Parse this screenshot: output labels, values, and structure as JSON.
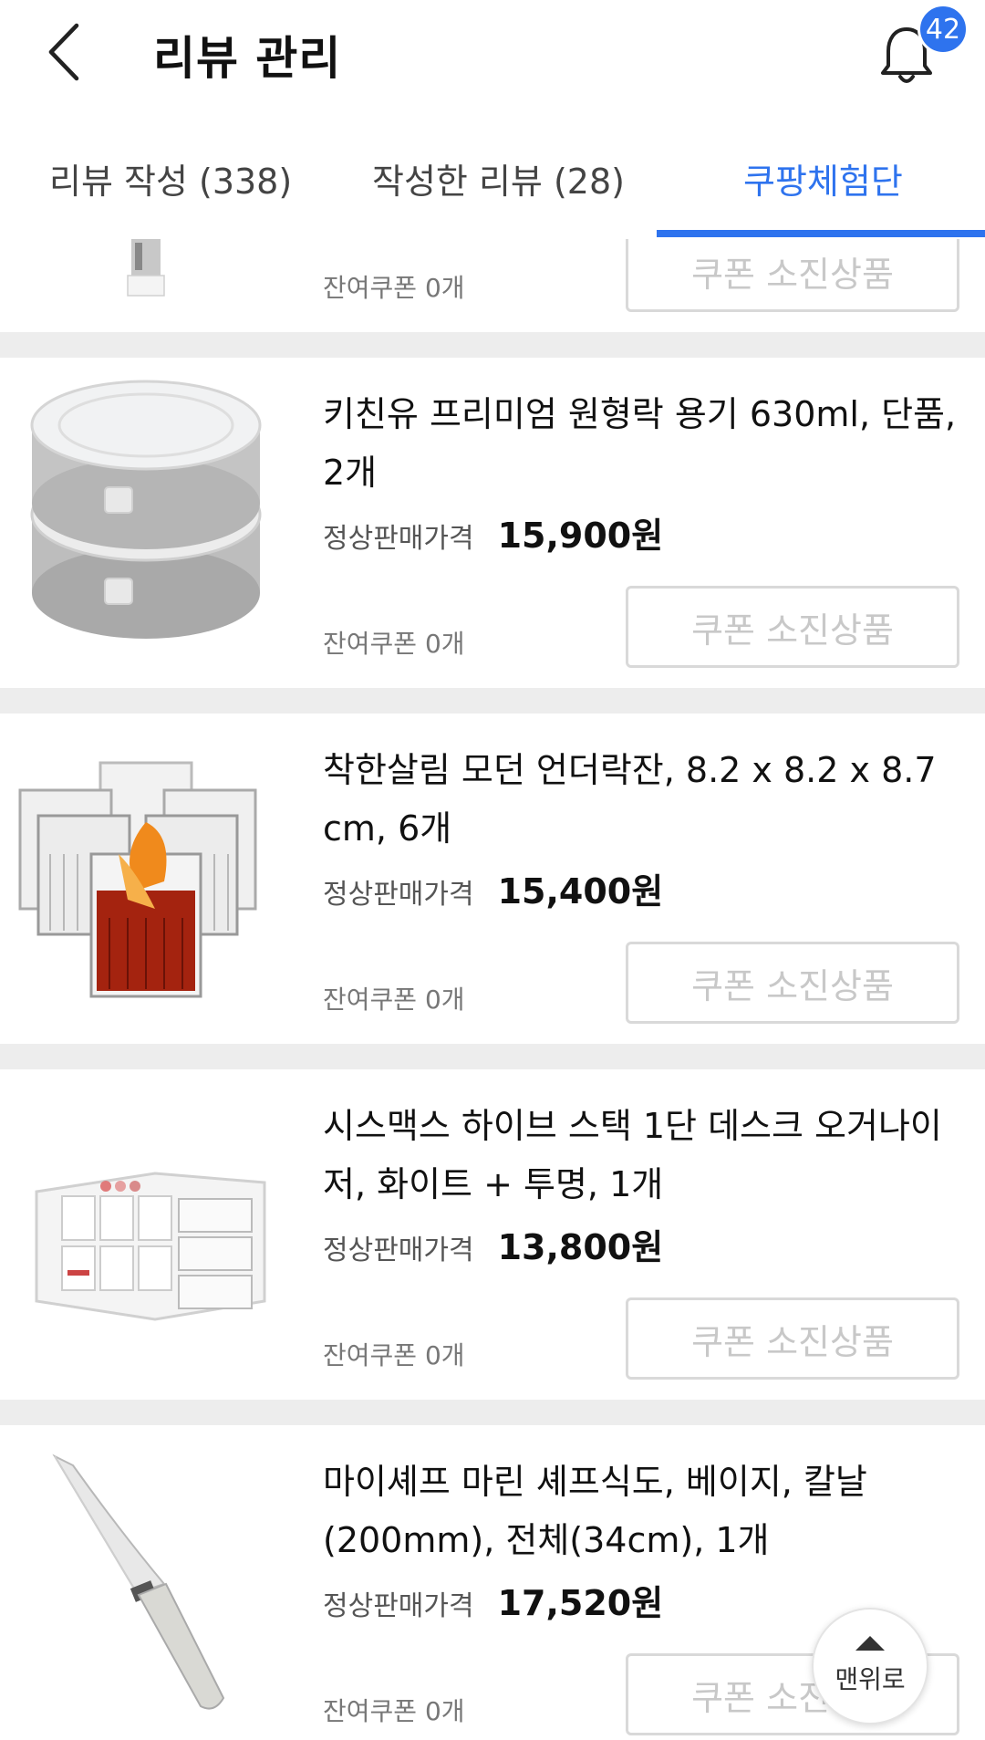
{
  "header": {
    "title": "리뷰 관리",
    "notification_count": "42"
  },
  "tabs": [
    {
      "label": "리뷰 작성 (338)",
      "active": false
    },
    {
      "label": "작성한 리뷰 (28)",
      "active": false
    },
    {
      "label": "쿠팡체험단",
      "active": true
    }
  ],
  "colors": {
    "accent": "#2e73ee",
    "separator": "#ededed",
    "button_border": "#d9d9d9",
    "button_text": "#c8c8c8"
  },
  "partial_item": {
    "remaining": "잔여쿠폰 0개",
    "button": "쿠폰 소진상품",
    "icon": "cup-product-thumb"
  },
  "items": [
    {
      "name": "키친유 프리미엄 원형락 용기 630ml, 단품, 2개",
      "price_label": "정상판매가격",
      "price": "15,900원",
      "remaining": "잔여쿠폰 0개",
      "button": "쿠폰 소진상품",
      "icon": "food-container-thumb"
    },
    {
      "name": "착한살림 모던 언더락잔, 8.2 x 8.2 x 8.7 cm, 6개",
      "price_label": "정상판매가격",
      "price": "15,400원",
      "remaining": "잔여쿠폰 0개",
      "button": "쿠폰 소진상품",
      "icon": "glass-set-thumb"
    },
    {
      "name": "시스맥스 하이브 스택 1단 데스크 오거나이저, 화이트 + 투명, 1개",
      "price_label": "정상판매가격",
      "price": "13,800원",
      "remaining": "잔여쿠폰 0개",
      "button": "쿠폰 소진상품",
      "icon": "desk-organizer-thumb"
    },
    {
      "name": "마이셰프 마린 셰프식도, 베이지, 칼날(200mm), 전체(34cm), 1개",
      "price_label": "정상판매가격",
      "price": "17,520원",
      "remaining": "잔여쿠폰 0개",
      "button": "쿠폰 소진상품",
      "icon": "chef-knife-thumb"
    }
  ],
  "scroll_top": {
    "label": "맨위로"
  }
}
